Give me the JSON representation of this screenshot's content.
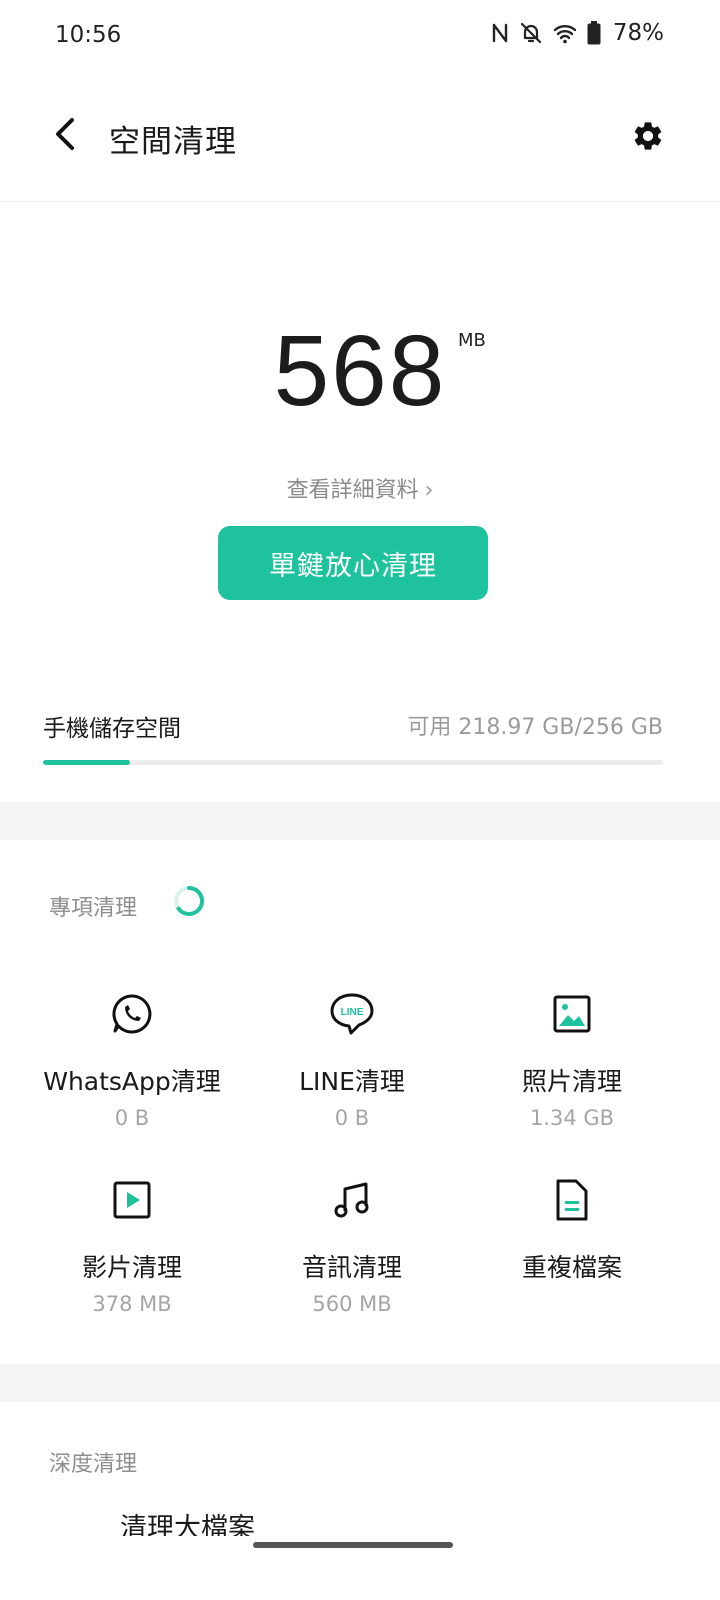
{
  "status_bar": {
    "time": "10:56",
    "battery_percent": "78%",
    "icons": [
      "nfc-icon",
      "mute-bell-icon",
      "wifi-icon",
      "battery-icon"
    ]
  },
  "app_bar": {
    "title": "空間清理",
    "back_icon": "back-arrow-icon",
    "settings_icon": "gear-icon"
  },
  "summary": {
    "junk_size": "568",
    "junk_unit": "MB",
    "details_link": "查看詳細資料",
    "clean_button": "單鍵放心清理"
  },
  "storage": {
    "label": "手機儲存空間",
    "value": "可用 218.97 GB/256 GB",
    "used_fraction": 0.14
  },
  "special_cleanup": {
    "title": "專項清理",
    "items": [
      {
        "label": "WhatsApp清理",
        "size": "0 B",
        "icon": "whatsapp-icon"
      },
      {
        "label": "LINE清理",
        "size": "0 B",
        "icon": "line-icon"
      },
      {
        "label": "照片清理",
        "size": "1.34 GB",
        "icon": "photo-icon"
      },
      {
        "label": "影片清理",
        "size": "378 MB",
        "icon": "video-icon"
      },
      {
        "label": "音訊清理",
        "size": "560 MB",
        "icon": "music-icon"
      },
      {
        "label": "重複檔案",
        "size": "",
        "icon": "duplicate-file-icon"
      }
    ]
  },
  "deep_cleanup": {
    "title": "深度清理",
    "first_item": "清理大檔案"
  },
  "colors": {
    "accent": "#1ec39d",
    "background": "#ffffff",
    "band": "#f5f5f5"
  }
}
